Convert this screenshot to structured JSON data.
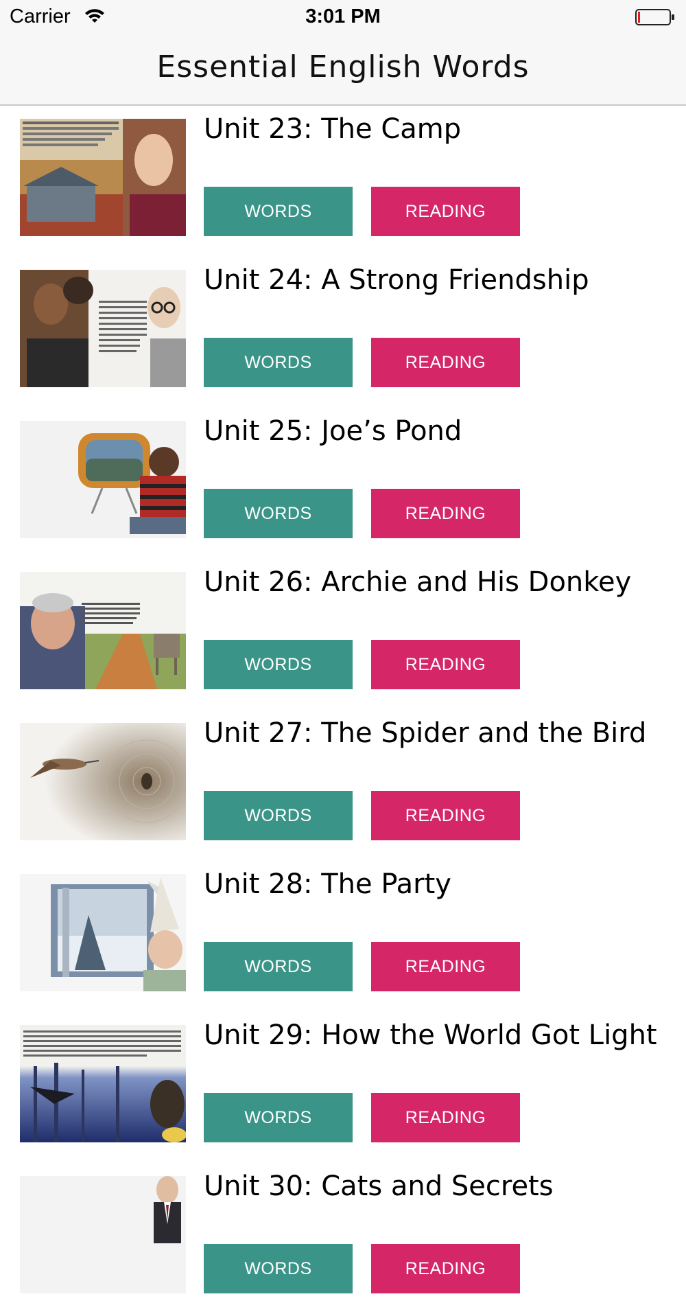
{
  "status_bar": {
    "carrier": "Carrier",
    "time": "3:01 PM"
  },
  "nav": {
    "title": "Essential English Words"
  },
  "colors": {
    "words_button": "#3a9488",
    "reading_button": "#d52667"
  },
  "units": [
    {
      "title": "Unit 23: The Camp",
      "thumbnail_icon": "cabin-girl-image",
      "words_label": "WORDS",
      "reading_label": "READING"
    },
    {
      "title": "Unit 24: A Strong Friendship",
      "thumbnail_icon": "strongman-boy-image",
      "words_label": "WORDS",
      "reading_label": "READING"
    },
    {
      "title": "Unit 25: Joe’s Pond",
      "thumbnail_icon": "tv-boy-image",
      "words_label": "WORDS",
      "reading_label": "READING"
    },
    {
      "title": "Unit 26: Archie and His Donkey",
      "thumbnail_icon": "man-donkey-image",
      "words_label": "WORDS",
      "reading_label": "READING"
    },
    {
      "title": "Unit 27: The Spider and the Bird",
      "thumbnail_icon": "bird-spider-image",
      "words_label": "WORDS",
      "reading_label": "READING"
    },
    {
      "title": "Unit 28: The Party",
      "thumbnail_icon": "window-party-hat-image",
      "words_label": "WORDS",
      "reading_label": "READING"
    },
    {
      "title": "Unit 29: How the World Got Light",
      "thumbnail_icon": "forest-raven-image",
      "words_label": "WORDS",
      "reading_label": "READING"
    },
    {
      "title": "Unit 30: Cats and Secrets",
      "thumbnail_icon": "man-suit-image",
      "words_label": "WORDS",
      "reading_label": "READING"
    }
  ]
}
